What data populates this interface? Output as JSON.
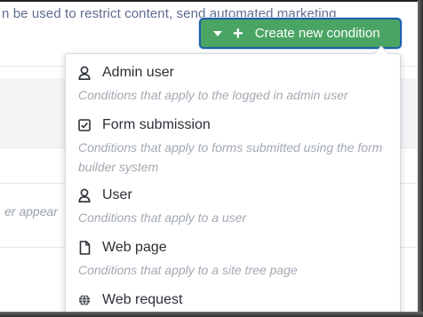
{
  "background": {
    "intro_text": "n be used to restrict content, send automated marketing",
    "partial_text": "er appear"
  },
  "create_button": {
    "label": "Create new condition",
    "icons": [
      "caret-down-icon",
      "plus-icon"
    ],
    "color": "#4aa564"
  },
  "menu": {
    "items": [
      {
        "icon": "user-icon",
        "title": "Admin user",
        "description": "Conditions that apply to the logged in admin user"
      },
      {
        "icon": "checkbox-icon",
        "title": "Form submission",
        "description": "Conditions that apply to forms submitted using the form builder system"
      },
      {
        "icon": "user-icon",
        "title": "User",
        "description": "Conditions that apply to a user"
      },
      {
        "icon": "file-icon",
        "title": "Web page",
        "description": "Conditions that apply to a site tree page"
      },
      {
        "icon": "globe-icon",
        "title": "Web request",
        "description": ""
      }
    ]
  }
}
